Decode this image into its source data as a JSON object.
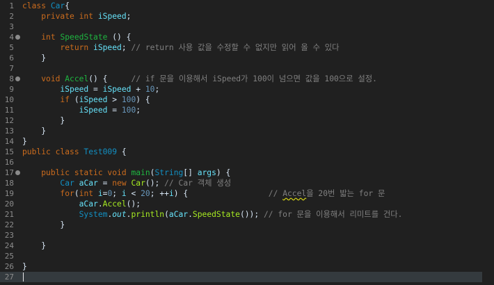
{
  "editor": {
    "lines": [
      {
        "n": "1",
        "fold": false,
        "tokens": [
          [
            "kw",
            "class "
          ],
          [
            "type",
            "Car"
          ],
          [
            "",
            "{"
          ]
        ]
      },
      {
        "n": "2",
        "fold": false,
        "tokens": [
          [
            "",
            "    "
          ],
          [
            "kw",
            "private int "
          ],
          [
            "fld",
            "iSpeed"
          ],
          [
            "",
            ";"
          ]
        ]
      },
      {
        "n": "3",
        "fold": false,
        "tokens": []
      },
      {
        "n": "4",
        "fold": true,
        "tokens": [
          [
            "",
            "    "
          ],
          [
            "kw",
            "int "
          ],
          [
            "mth",
            "SpeedState"
          ],
          [
            "",
            " () {"
          ]
        ]
      },
      {
        "n": "5",
        "fold": false,
        "tokens": [
          [
            "",
            "        "
          ],
          [
            "kw",
            "return "
          ],
          [
            "fld",
            "iSpeed"
          ],
          [
            "",
            "; "
          ],
          [
            "cmt",
            "// return 사용 값을 수정할 수 없지만 읽어 올 수 있다"
          ]
        ]
      },
      {
        "n": "6",
        "fold": false,
        "tokens": [
          [
            "",
            "    }"
          ]
        ]
      },
      {
        "n": "7",
        "fold": false,
        "tokens": []
      },
      {
        "n": "8",
        "fold": true,
        "tokens": [
          [
            "",
            "    "
          ],
          [
            "kw",
            "void "
          ],
          [
            "mth",
            "Accel"
          ],
          [
            "",
            "() {     "
          ],
          [
            "cmt",
            "// if 문을 이용해서 iSpeed가 100이 넘으면 값을 100으로 설정."
          ]
        ]
      },
      {
        "n": "9",
        "fold": false,
        "tokens": [
          [
            "",
            "        "
          ],
          [
            "fld",
            "iSpeed"
          ],
          [
            "",
            " = "
          ],
          [
            "fld",
            "iSpeed"
          ],
          [
            "",
            " + "
          ],
          [
            "num",
            "10"
          ],
          [
            "",
            ";"
          ]
        ]
      },
      {
        "n": "10",
        "fold": false,
        "tokens": [
          [
            "",
            "        "
          ],
          [
            "kw",
            "if "
          ],
          [
            "",
            "("
          ],
          [
            "fld",
            "iSpeed"
          ],
          [
            "",
            " > "
          ],
          [
            "num",
            "100"
          ],
          [
            "",
            ") {"
          ]
        ]
      },
      {
        "n": "11",
        "fold": false,
        "tokens": [
          [
            "",
            "            "
          ],
          [
            "fld",
            "iSpeed"
          ],
          [
            "",
            " = "
          ],
          [
            "num",
            "100"
          ],
          [
            "",
            ";"
          ]
        ]
      },
      {
        "n": "12",
        "fold": false,
        "tokens": [
          [
            "",
            "        }"
          ]
        ]
      },
      {
        "n": "13",
        "fold": false,
        "tokens": [
          [
            "",
            "    }"
          ]
        ]
      },
      {
        "n": "14",
        "fold": false,
        "tokens": [
          [
            "",
            "}"
          ]
        ]
      },
      {
        "n": "15",
        "fold": false,
        "tokens": [
          [
            "kw",
            "public class "
          ],
          [
            "type",
            "Test009"
          ],
          [
            "",
            " {"
          ]
        ]
      },
      {
        "n": "16",
        "fold": false,
        "tokens": []
      },
      {
        "n": "17",
        "fold": true,
        "tokens": [
          [
            "",
            "    "
          ],
          [
            "kw",
            "public static void "
          ],
          [
            "mth",
            "main"
          ],
          [
            "",
            "("
          ],
          [
            "type",
            "String"
          ],
          [
            "",
            "[] "
          ],
          [
            "fld",
            "args"
          ],
          [
            "",
            ") {"
          ]
        ]
      },
      {
        "n": "18",
        "fold": false,
        "tokens": [
          [
            "",
            "        "
          ],
          [
            "type",
            "Car "
          ],
          [
            "fld",
            "aCar"
          ],
          [
            "",
            " = "
          ],
          [
            "kw",
            "new "
          ],
          [
            "call",
            "Car"
          ],
          [
            "",
            "(); "
          ],
          [
            "cmt",
            "// Car 객체 생성"
          ]
        ]
      },
      {
        "n": "19",
        "fold": false,
        "tokens": [
          [
            "",
            "        "
          ],
          [
            "kw",
            "for"
          ],
          [
            "",
            "("
          ],
          [
            "kw",
            "int "
          ],
          [
            "fld",
            "i"
          ],
          [
            "",
            "="
          ],
          [
            "num",
            "0"
          ],
          [
            "",
            "; "
          ],
          [
            "fld",
            "i"
          ],
          [
            "",
            " < "
          ],
          [
            "num",
            "20"
          ],
          [
            "",
            "; ++"
          ],
          [
            "fld",
            "i"
          ],
          [
            "",
            ") {                 "
          ],
          [
            "cmt",
            "// "
          ],
          [
            "cmt sq",
            "Accel"
          ],
          [
            "cmt",
            "을 20번 밟는 for 문"
          ]
        ]
      },
      {
        "n": "20",
        "fold": false,
        "tokens": [
          [
            "",
            "            "
          ],
          [
            "fld",
            "aCar"
          ],
          [
            "",
            "."
          ],
          [
            "call",
            "Accel"
          ],
          [
            "",
            "();"
          ]
        ]
      },
      {
        "n": "21",
        "fold": false,
        "tokens": [
          [
            "",
            "            "
          ],
          [
            "type",
            "System"
          ],
          [
            "",
            "."
          ],
          [
            "fld ital",
            "out"
          ],
          [
            "",
            "."
          ],
          [
            "call",
            "println"
          ],
          [
            "",
            "("
          ],
          [
            "fld",
            "aCar"
          ],
          [
            "",
            "."
          ],
          [
            "call",
            "SpeedState"
          ],
          [
            "",
            "()); "
          ],
          [
            "cmt",
            "// for 문을 이용해서 리미트를 건다."
          ]
        ]
      },
      {
        "n": "22",
        "fold": false,
        "tokens": [
          [
            "",
            "        }"
          ]
        ]
      },
      {
        "n": "23",
        "fold": false,
        "tokens": []
      },
      {
        "n": "24",
        "fold": false,
        "tokens": [
          [
            "",
            "    }"
          ]
        ]
      },
      {
        "n": "25",
        "fold": false,
        "tokens": []
      },
      {
        "n": "26",
        "fold": false,
        "tokens": [
          [
            "",
            "}"
          ]
        ]
      },
      {
        "n": "27",
        "fold": false,
        "current": true,
        "tokens": []
      }
    ]
  }
}
